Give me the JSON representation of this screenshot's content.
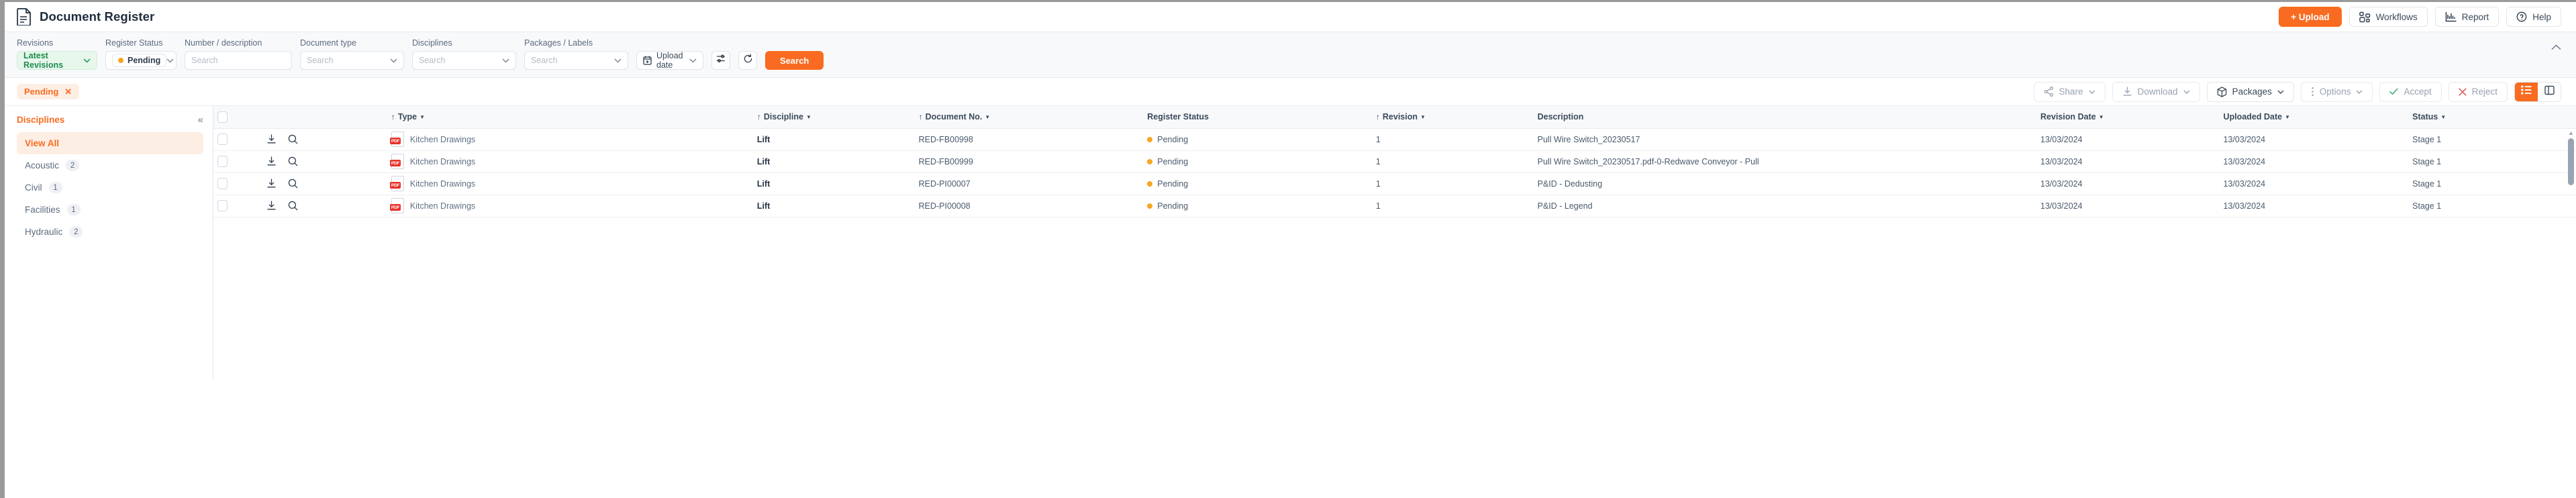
{
  "header": {
    "title": "Document Register",
    "buttons": [
      {
        "label": "+ Upload",
        "name": "upload-button"
      },
      {
        "label": "Workflows",
        "name": "workflows-button"
      },
      {
        "label": "Report",
        "name": "report-button"
      },
      {
        "label": "Help",
        "name": "help-button"
      }
    ]
  },
  "filters": {
    "revisions": {
      "label": "Revisions",
      "value": "Latest Revisions"
    },
    "register_status": {
      "label": "Register Status",
      "value": "Pending"
    },
    "number_description": {
      "label": "Number / description",
      "placeholder": "Search",
      "value": ""
    },
    "document_type": {
      "label": "Document type",
      "placeholder": "Search",
      "value": ""
    },
    "disciplines": {
      "label": "Disciplines",
      "placeholder": "Search",
      "value": ""
    },
    "packages_labels": {
      "label": "Packages / Labels",
      "placeholder": "Search",
      "value": ""
    },
    "upload_date": {
      "label": "Upload date"
    },
    "search_button": "Search"
  },
  "actionbar": {
    "chip": {
      "label": "Pending",
      "close": "✕"
    },
    "buttons": [
      {
        "label": "Share",
        "name": "share-button"
      },
      {
        "label": "Download",
        "name": "download-button"
      },
      {
        "label": "Packages",
        "name": "packages-button"
      },
      {
        "label": "Options",
        "name": "options-button"
      },
      {
        "label": "Accept",
        "name": "accept-button"
      },
      {
        "label": "Reject",
        "name": "reject-button"
      }
    ]
  },
  "sidebar": {
    "title": "Disciplines",
    "items": [
      {
        "label": "View All",
        "count": "",
        "active": true
      },
      {
        "label": "Acoustic",
        "count": "2",
        "active": false
      },
      {
        "label": "Civil",
        "count": "1",
        "active": false
      },
      {
        "label": "Facilities",
        "count": "1",
        "active": false
      },
      {
        "label": "Hydraulic",
        "count": "2",
        "active": false
      }
    ]
  },
  "table": {
    "columns": [
      {
        "label": "Type",
        "sortable": true
      },
      {
        "label": "Discipline",
        "sortable": true
      },
      {
        "label": "Document No.",
        "sortable": true
      },
      {
        "label": "Register Status",
        "sortable": false
      },
      {
        "label": "Revision",
        "sortable": true
      },
      {
        "label": "Description",
        "sortable": false
      },
      {
        "label": "Revision Date",
        "sortable": true
      },
      {
        "label": "Uploaded Date",
        "sortable": true
      },
      {
        "label": "Status",
        "sortable": true
      }
    ],
    "rows": [
      {
        "type": "Kitchen Drawings",
        "filetype": "PDF",
        "discipline": "Lift",
        "document_no": "RED-FB00998",
        "register_status": "Pending",
        "revision": "1",
        "description": "Pull Wire Switch_20230517",
        "revision_date": "13/03/2024",
        "uploaded_date": "13/03/2024",
        "status": "Stage 1"
      },
      {
        "type": "Kitchen Drawings",
        "filetype": "PDF",
        "discipline": "Lift",
        "document_no": "RED-FB00999",
        "register_status": "Pending",
        "revision": "1",
        "description": "Pull Wire Switch_20230517.pdf-0-Redwave Conveyor - Pull",
        "revision_date": "13/03/2024",
        "uploaded_date": "13/03/2024",
        "status": "Stage 1"
      },
      {
        "type": "Kitchen Drawings",
        "filetype": "PDF",
        "discipline": "Lift",
        "document_no": "RED-PI00007",
        "register_status": "Pending",
        "revision": "1",
        "description": "P&ID - Dedusting",
        "revision_date": "13/03/2024",
        "uploaded_date": "13/03/2024",
        "status": "Stage 1"
      },
      {
        "type": "Kitchen Drawings",
        "filetype": "PDF",
        "discipline": "Lift",
        "document_no": "RED-PI00008",
        "register_status": "Pending",
        "revision": "1",
        "description": "P&ID - Legend",
        "revision_date": "13/03/2024",
        "uploaded_date": "13/03/2024",
        "status": "Stage 1"
      }
    ]
  },
  "colors": {
    "accent": "#f96b20",
    "pending": "#f5a623",
    "green": "#1e8b4d",
    "pdf_red": "#e8322a",
    "text": "#3b4a5a"
  }
}
